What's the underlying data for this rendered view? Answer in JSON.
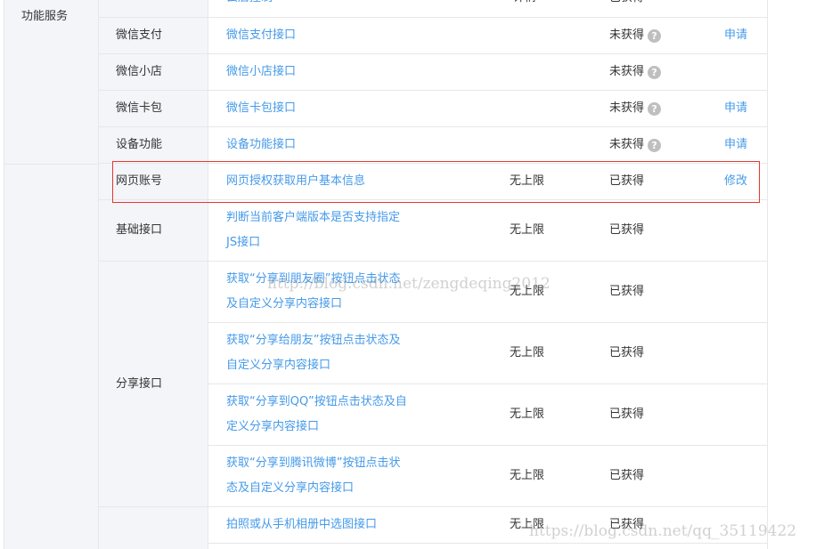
{
  "top_partial": {
    "link": "云店控制",
    "limit": "详情",
    "status": "已获得"
  },
  "categories": {
    "feature_services": "功能服务"
  },
  "rows": [
    {
      "name": "微信支付",
      "link": "微信支付接口",
      "limit": "",
      "status": "未获得",
      "help": true,
      "action": "申请"
    },
    {
      "name": "微信小店",
      "link": "微信小店接口",
      "limit": "",
      "status": "未获得",
      "help": true,
      "action": ""
    },
    {
      "name": "微信卡包",
      "link": "微信卡包接口",
      "limit": "",
      "status": "未获得",
      "help": true,
      "action": "申请"
    },
    {
      "name": "设备功能",
      "link": "设备功能接口",
      "limit": "",
      "status": "未获得",
      "help": true,
      "action": "申请"
    },
    {
      "name": "网页账号",
      "link": "网页授权获取用户基本信息",
      "limit": "无上限",
      "status": "已获得",
      "help": false,
      "action": "修改"
    },
    {
      "name": "基础接口",
      "link": "判断当前客户端版本是否支持指定JS接口",
      "limit": "无上限",
      "status": "已获得",
      "help": false,
      "action": ""
    },
    {
      "name": "分享接口",
      "link": "获取“分享到朋友圈”按钮点击状态及自定义分享内容接口",
      "limit": "无上限",
      "status": "已获得",
      "help": false,
      "action": ""
    },
    {
      "name": "",
      "link": "获取“分享给朋友”按钮点击状态及自定义分享内容接口",
      "limit": "无上限",
      "status": "已获得",
      "help": false,
      "action": ""
    },
    {
      "name": "",
      "link": "获取“分享到QQ”按钮点击状态及自定义分享内容接口",
      "limit": "无上限",
      "status": "已获得",
      "help": false,
      "action": ""
    },
    {
      "name": "",
      "link": "获取“分享到腾讯微博”按钮点击状态及自定义分享内容接口",
      "limit": "无上限",
      "status": "已获得",
      "help": false,
      "action": ""
    },
    {
      "name": "",
      "link": "拍照或从手机相册中选图接口",
      "limit": "无上限",
      "status": "已获得",
      "help": false,
      "action": ""
    }
  ],
  "help_glyph": "?",
  "watermarks": {
    "center": "http://blog.csdn.net/zengdeqing2012",
    "bottom": "https://blog.csdn.net/qq_35119422"
  }
}
